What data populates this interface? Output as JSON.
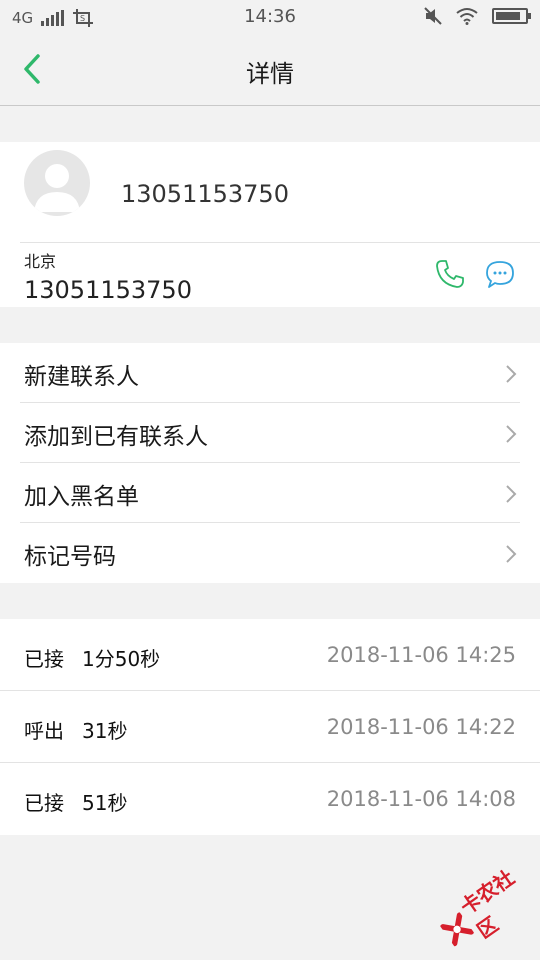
{
  "status_bar": {
    "network": "4G",
    "time": "14:36",
    "battery_level": 0.85
  },
  "header": {
    "title": "详情"
  },
  "contact": {
    "number": "13051153750",
    "location": "北京",
    "phone": "13051153750"
  },
  "menu": {
    "items": [
      {
        "label": "新建联系人"
      },
      {
        "label": "添加到已有联系人"
      },
      {
        "label": "加入黑名单"
      },
      {
        "label": "标记号码"
      }
    ]
  },
  "calls": [
    {
      "type": "已接",
      "duration": "1分50秒",
      "time": "2018-11-06  14:25"
    },
    {
      "type": "呼出",
      "duration": "31秒",
      "time": "2018-11-06  14:22"
    },
    {
      "type": "已接",
      "duration": "51秒",
      "time": "2018-11-06  14:08"
    }
  ],
  "watermark": {
    "text": "卡农社区"
  },
  "colors": {
    "accent_green": "#2fb86b",
    "message_blue": "#35a4dd",
    "watermark_red": "#d61f2c"
  }
}
